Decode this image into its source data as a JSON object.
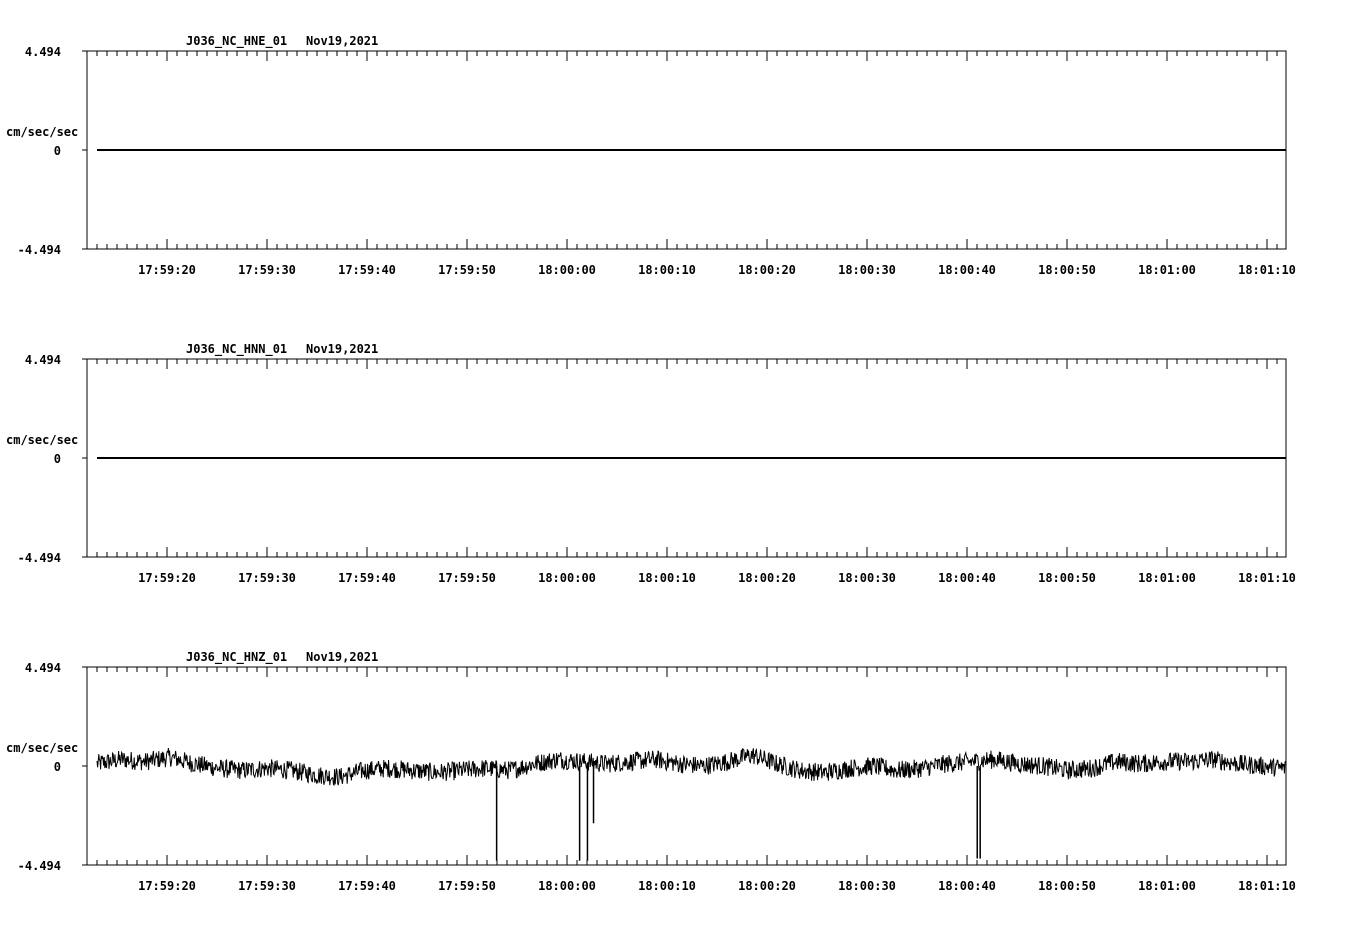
{
  "chart_data": [
    {
      "type": "line",
      "station_label": "J036_NC_HNE_01",
      "date_label": "Nov19,2021",
      "ylabel": "cm/sec/sec",
      "ylim": [
        -4.494,
        4.494
      ],
      "y_ticks": [
        "4.494",
        "0",
        "-4.494"
      ],
      "x_ticks": [
        "17:59:20",
        "17:59:30",
        "17:59:40",
        "17:59:50",
        "18:00:00",
        "18:00:10",
        "18:00:20",
        "18:00:30",
        "18:00:40",
        "18:00:50",
        "18:01:00",
        "18:01:10"
      ],
      "trace": "flat",
      "series": [
        {
          "values": [
            0,
            0
          ]
        }
      ]
    },
    {
      "type": "line",
      "station_label": "J036_NC_HNN_01",
      "date_label": "Nov19,2021",
      "ylabel": "cm/sec/sec",
      "ylim": [
        -4.494,
        4.494
      ],
      "y_ticks": [
        "4.494",
        "0",
        "-4.494"
      ],
      "x_ticks": [
        "17:59:20",
        "17:59:30",
        "17:59:40",
        "17:59:50",
        "18:00:00",
        "18:00:10",
        "18:00:20",
        "18:00:30",
        "18:00:40",
        "18:00:50",
        "18:01:00",
        "18:01:10"
      ],
      "trace": "flat",
      "series": [
        {
          "values": [
            0,
            0
          ]
        }
      ]
    },
    {
      "type": "line",
      "station_label": "J036_NC_HNZ_01",
      "date_label": "Nov19,2021",
      "ylabel": "cm/sec/sec",
      "ylim": [
        -4.494,
        4.494
      ],
      "y_ticks": [
        "4.494",
        "0",
        "-4.494"
      ],
      "x_ticks": [
        "17:59:20",
        "17:59:30",
        "17:59:40",
        "17:59:50",
        "18:00:00",
        "18:00:10",
        "18:00:20",
        "18:00:30",
        "18:00:40",
        "18:00:50",
        "18:01:00",
        "18:01:10"
      ],
      "trace": "noisy",
      "series": [
        {
          "values": [
            0.1,
            0.3,
            0.2,
            0.4,
            0.1,
            -0.1,
            -0.2,
            -0.1,
            -0.2,
            -0.4,
            -0.5,
            -0.2,
            -0.1,
            -0.2,
            -0.3,
            -0.2,
            -0.1,
            -0.2,
            0.1,
            0.3,
            0.2,
            0.1,
            0.2,
            0.3,
            0.1,
            0.0,
            0.2,
            0.5,
            0.1,
            -0.2,
            -0.3,
            -0.1,
            0.0,
            -0.2,
            -0.1,
            0.1,
            0.2,
            0.3,
            0.1,
            0.0,
            -0.2,
            -0.1,
            0.2,
            0.1,
            0.2,
            0.2,
            0.3,
            0.1,
            0.0,
            -0.1
          ],
          "spikes": [
            {
              "at_fraction": 0.3361,
              "value": -4.3
            },
            {
              "at_fraction": 0.4059,
              "value": -4.3
            },
            {
              "at_fraction": 0.4125,
              "value": -4.3
            },
            {
              "at_fraction": 0.4176,
              "value": -2.6
            },
            {
              "at_fraction": 0.7403,
              "value": -4.2
            },
            {
              "at_fraction": 0.7428,
              "value": -4.2
            }
          ]
        }
      ]
    }
  ]
}
